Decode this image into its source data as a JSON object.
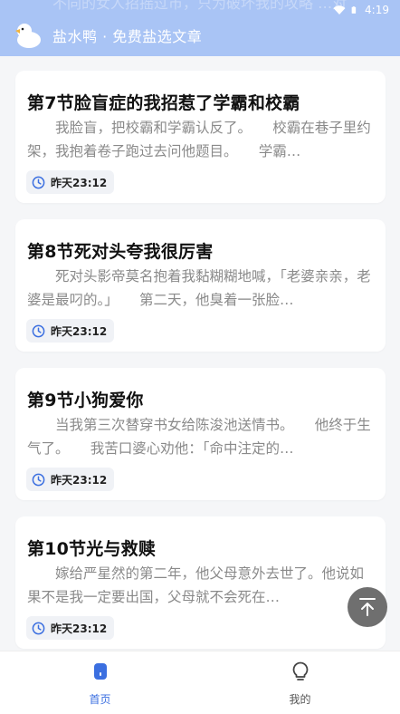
{
  "status_bar": {
    "time": "4:19"
  },
  "header": {
    "title": "盐水鸭 · 免费盐选文章",
    "ghost_text": "不同的女人招摇过市，只为破坏我的攻略 …对"
  },
  "cards": [
    {
      "title": "第7节脸盲症的我招惹了学霸和校霸",
      "body": "　　我脸盲，把校霸和学霸认反了。　　校霸在巷子里约架，我抱着卷子跑过去问他题目。　　学霸…",
      "time": "昨天23:12"
    },
    {
      "title": "第8节死对头夸我很厉害",
      "body": "　　死对头影帝莫名抱着我黏糊糊地喊，「老婆亲亲，老婆是最叼的。」　　第二天，他臭着一张脸…",
      "time": "昨天23:12"
    },
    {
      "title": "第9节小狗爱你",
      "body": "　　当我第三次替穿书女给陈浚池送情书。　　他终于生气了。　　我苦口婆心劝他：「命中注定的…",
      "time": "昨天23:12"
    },
    {
      "title": "第10节光与救赎",
      "body": "　　嫁给严星然的第二年，他父母意外去世了。他说如果不是我一定要出国，父母就不会死在…",
      "time": "昨天23:12"
    }
  ],
  "bottom_nav": [
    {
      "label": "首页",
      "icon": "home-icon",
      "active": true
    },
    {
      "label": "我的",
      "icon": "bulb-icon",
      "active": false
    }
  ],
  "colors": {
    "header": "#a9c4f5",
    "accent": "#3b6fe0",
    "fab": "#6f6f6f"
  }
}
